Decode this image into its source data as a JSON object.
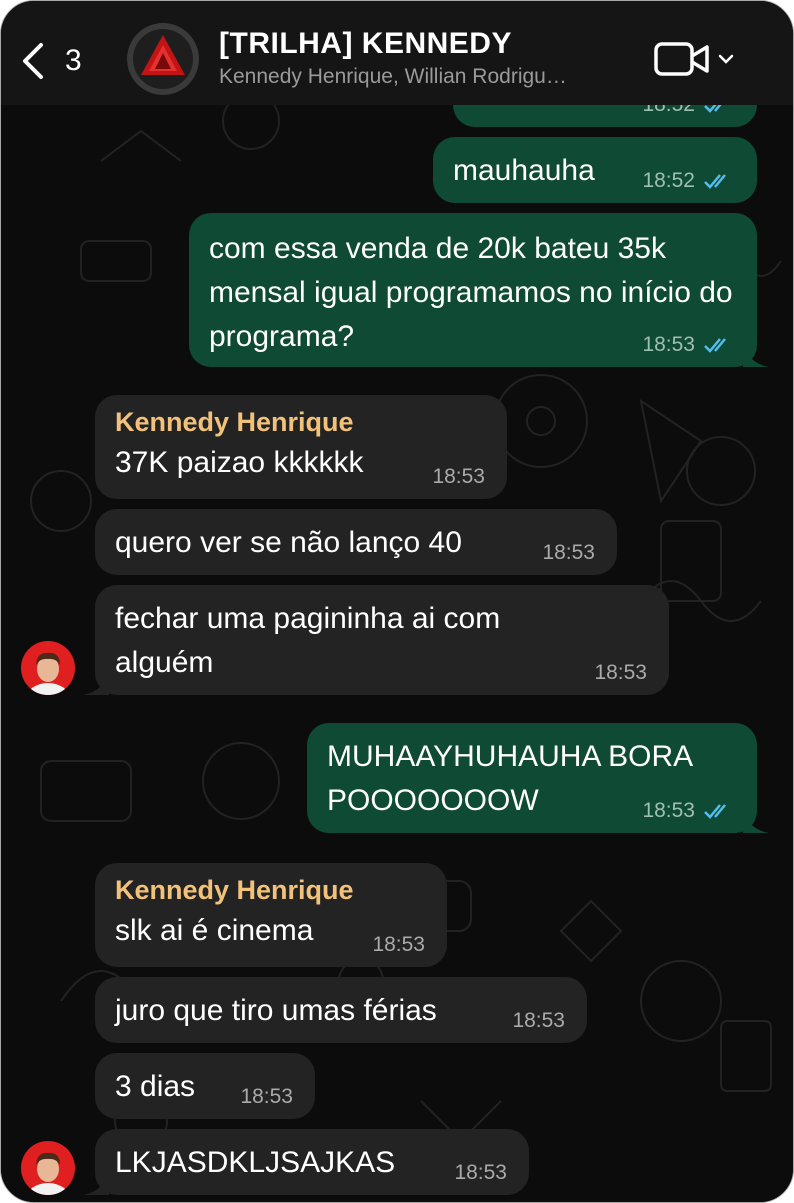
{
  "header": {
    "back_count": "3",
    "title": "[TRILHA] KENNEDY",
    "subtitle": "Kennedy Henrique, Willian Rodrigu…",
    "icons": {
      "back": "chevron-left-icon",
      "video": "video-camera-icon",
      "dropdown": "chevron-down-icon"
    }
  },
  "messages": [
    {
      "direction": "out",
      "text": "",
      "time": "18:52",
      "status": "read"
    },
    {
      "direction": "out",
      "text": "mauhauha",
      "time": "18:52",
      "status": "read"
    },
    {
      "direction": "out",
      "text": "com essa venda de 20k bateu 35k mensal igual programamos no início do programa?",
      "time": "18:53",
      "status": "read"
    },
    {
      "direction": "in",
      "sender": "Kennedy Henrique",
      "text": "37K paizao kkkkkk",
      "time": "18:53"
    },
    {
      "direction": "in",
      "text": "quero ver se não lanço 40",
      "time": "18:53"
    },
    {
      "direction": "in",
      "text": "fechar uma pagininha ai com alguém",
      "time": "18:53"
    },
    {
      "direction": "out",
      "text": "MUHAAYHUHAUHA BORA POOOOOOOW",
      "time": "18:53",
      "status": "read"
    },
    {
      "direction": "in",
      "sender": "Kennedy Henrique",
      "text": "slk ai é cinema",
      "time": "18:53"
    },
    {
      "direction": "in",
      "text": "juro que tiro umas férias",
      "time": "18:53"
    },
    {
      "direction": "in",
      "text": "3 dias",
      "time": "18:53"
    },
    {
      "direction": "in",
      "text": "LKJASDKLJSAJKAS",
      "time": "18:53"
    }
  ],
  "colors": {
    "outgoing_bubble": "#0f4a34",
    "incoming_bubble": "#232323",
    "sender_name": "#f2c27a",
    "read_ticks": "#53bdeb"
  }
}
